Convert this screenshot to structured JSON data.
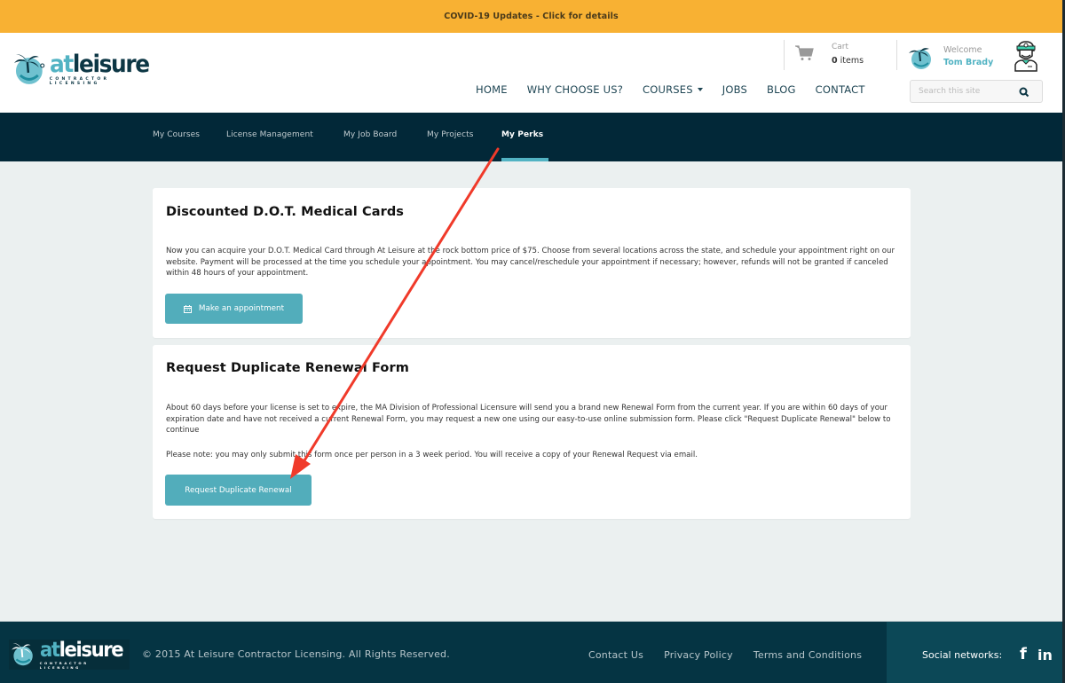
{
  "banner": {
    "text": "COVID-19 Updates - Click for details",
    "color": "#f8b133"
  },
  "brand": {
    "logo_at": "at",
    "logo_leisure": "leisure",
    "logo_subtitle": "CONTRACTOR LICENSING"
  },
  "header": {
    "cart": {
      "label": "Cart",
      "count": "0",
      "count_suffix": " items",
      "icon": "cart-icon"
    },
    "welcome": {
      "label": "Welcome",
      "name": "Tom Brady"
    },
    "nav": [
      {
        "label": "HOME"
      },
      {
        "label": "WHY CHOOSE US?"
      },
      {
        "label": "COURSES",
        "has_dropdown": true
      },
      {
        "label": "JOBS"
      },
      {
        "label": "BLOG"
      },
      {
        "label": "CONTACT"
      }
    ],
    "search": {
      "placeholder": "Search this site",
      "value": "",
      "icon": "search-icon"
    }
  },
  "subnav": {
    "items": [
      {
        "label": "My Courses"
      },
      {
        "label": "License Management"
      },
      {
        "label": "My Job Board"
      },
      {
        "label": "My Projects"
      },
      {
        "label": "My Perks",
        "active": true
      }
    ]
  },
  "cards": [
    {
      "title": "Discounted D.O.T. Medical Cards",
      "body": "Now you can acquire your D.O.T. Medical Card through At Leisure at the rock bottom price of $75. Choose from several locations across the state, and schedule your appointment right on our website. Payment will be processed at the time you schedule your appointment. You may cancel/reschedule your appointment if necessary; however, refunds will not be granted if canceled within 48 hours of your appointment.",
      "button": {
        "label": "Make an appointment",
        "icon": "calendar-icon"
      }
    },
    {
      "title": "Request Duplicate Renewal Form",
      "body": "About 60 days before your license is set to expire, the MA Division of Professional Licensure will send you a brand new Renewal Form from the current year. If you are within 60 days of your expiration date and have not received a current Renewal Form, you may request a new one using our easy-to-use online submission form. Please click \"Request Duplicate Renewal\" below to continue",
      "note": "Please note: you may only submit this form once per person in a 3 week period. You will receive a copy of your Renewal Request via email.",
      "button": {
        "label": "Request Duplicate Renewal"
      }
    }
  ],
  "footer": {
    "copyright": "© 2015 At Leisure Contractor Licensing. All Rights Reserved.",
    "links": [
      {
        "label": "Contact Us"
      },
      {
        "label": "Privacy Policy"
      },
      {
        "label": "Terms and Conditions"
      }
    ],
    "social_label": "Social networks:",
    "social": [
      {
        "name": "facebook",
        "glyph": "f"
      },
      {
        "name": "linkedin",
        "glyph": "in"
      }
    ]
  },
  "colors": {
    "accent": "#52adbb",
    "navy": "#022838",
    "footer": "#053443",
    "annotation_arrow": "#f03a2a"
  }
}
